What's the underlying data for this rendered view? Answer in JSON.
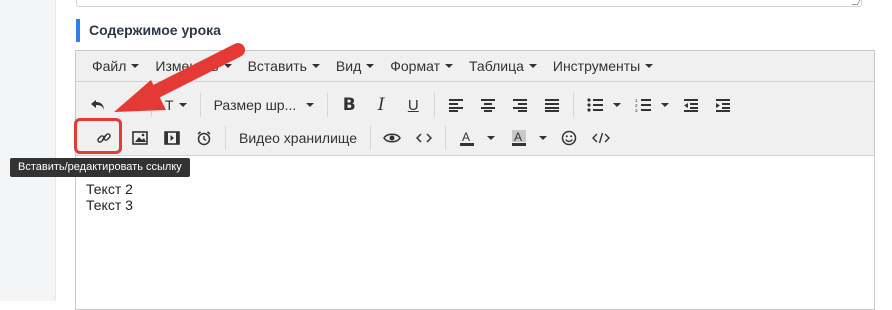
{
  "section": {
    "title": "Содержимое урока"
  },
  "menubar": {
    "items": [
      {
        "label": "Файл"
      },
      {
        "label": "Изменить"
      },
      {
        "label": "Вставить"
      },
      {
        "label": "Вид"
      },
      {
        "label": "Формат"
      },
      {
        "label": "Таблица"
      },
      {
        "label": "Инструменты"
      }
    ]
  },
  "toolbar": {
    "format_label": "Т",
    "font_size_label": "Размер шр...",
    "video_storage_label": "Видео хранилище"
  },
  "tooltip": {
    "text": "Вставить/редактировать ссылку"
  },
  "content": {
    "lines": [
      "Текст 2",
      "Текст 3"
    ]
  },
  "colors": {
    "accent": "#2f80ed",
    "highlight": "#e53935",
    "toolbar_bg": "#f0f0f0"
  },
  "icons": [
    "undo-icon",
    "redo-icon",
    "bold-icon",
    "italic-icon",
    "underline-icon",
    "align-left-icon",
    "align-center-icon",
    "align-right-icon",
    "align-justify-icon",
    "bullet-list-icon",
    "numbered-list-icon",
    "outdent-icon",
    "indent-icon",
    "link-icon",
    "image-icon",
    "media-icon",
    "alarm-icon",
    "eye-icon",
    "code-icon",
    "text-color-icon",
    "background-color-icon",
    "emoji-icon",
    "source-code-icon"
  ]
}
